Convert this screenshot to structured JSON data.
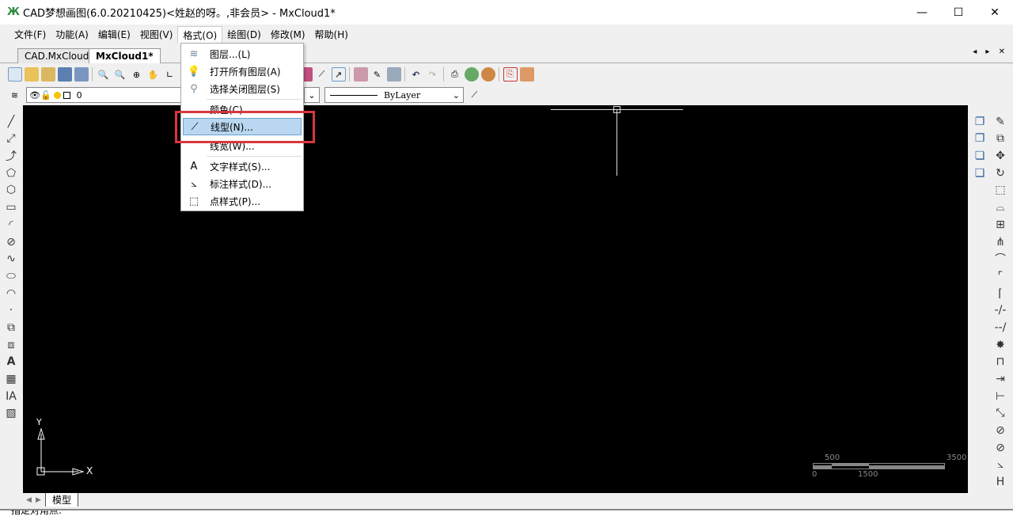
{
  "window": {
    "title": "CAD梦想画图(6.0.20210425)<姓赵的呀。,非会员> - MxCloud1*",
    "minimize": "—",
    "maximize": "☐",
    "close": "✕"
  },
  "menubar": [
    "文件(F)",
    "功能(A)",
    "编辑(E)",
    "视图(V)",
    "格式(O)",
    "绘图(D)",
    "修改(M)",
    "帮助(H)"
  ],
  "doc_tabs": [
    "CAD.MxCloud",
    "MxCloud1*"
  ],
  "tab_nav": "◂ ▸ ✕",
  "layer_combo": {
    "value": "0"
  },
  "linetype_combo": {
    "value": "ByLayer"
  },
  "format_menu": {
    "items": [
      {
        "icon": "layers-icon",
        "label": "图层...(L)"
      },
      {
        "icon": "bulb-icon",
        "label": "打开所有图层(A)"
      },
      {
        "icon": "layer-off-icon",
        "label": "选择关闭图层(S)"
      },
      {
        "icon": "",
        "label": "颜色(C)"
      },
      {
        "icon": "linetype-icon",
        "label": "线型(N)...",
        "highlighted": true
      },
      {
        "icon": "",
        "label": "线宽(W)..."
      },
      {
        "icon": "text-style-icon",
        "label": "文字样式(S)..."
      },
      {
        "icon": "dim-style-icon",
        "label": "标注样式(D)..."
      },
      {
        "icon": "point-style-icon",
        "label": "点样式(P)..."
      }
    ]
  },
  "ucs": {
    "x": "X",
    "y": "Y"
  },
  "scale_bar": {
    "labels_top": [
      "500",
      "3500"
    ],
    "labels_bottom": [
      "0",
      "1500"
    ]
  },
  "layout_tabs": {
    "model": "模型"
  },
  "command_line": {
    "prompt": "指定对角点:"
  },
  "colors": {
    "canvas": "#000000",
    "highlight": "#b9d7f0",
    "annotation": "#d9363e"
  }
}
